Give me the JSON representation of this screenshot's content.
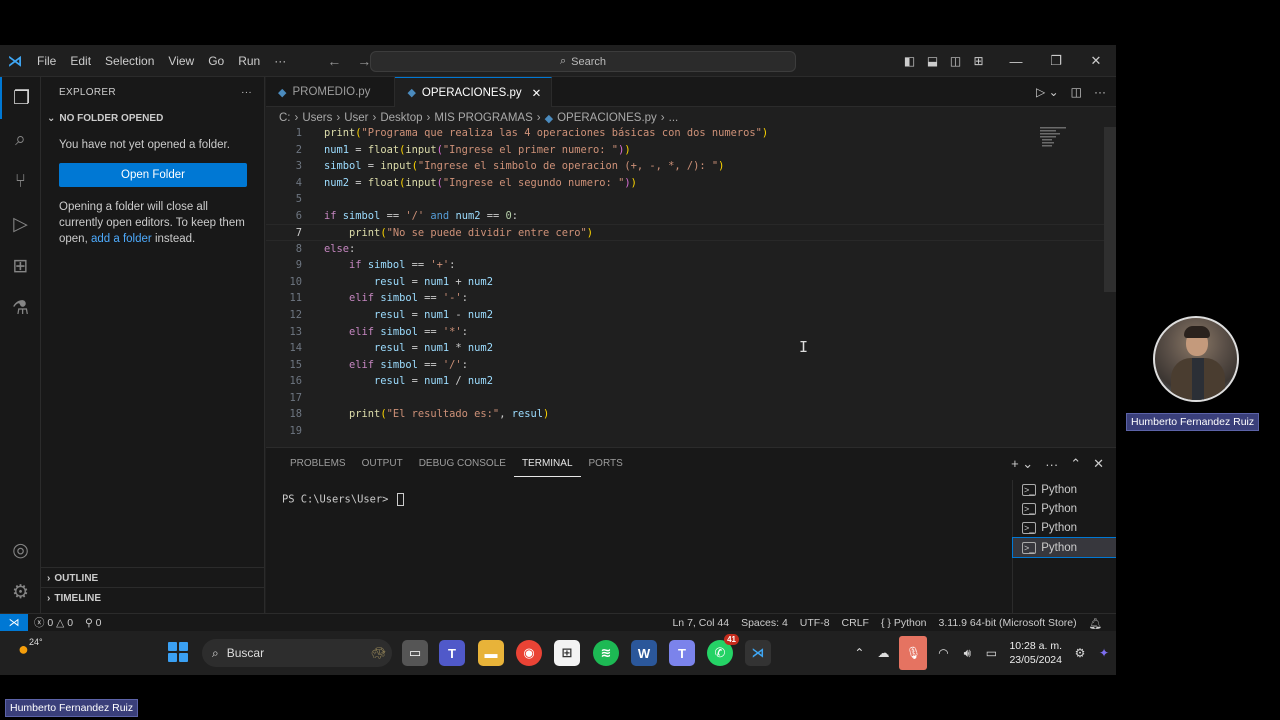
{
  "menu": [
    "File",
    "Edit",
    "Selection",
    "View",
    "Go",
    "Run",
    "···"
  ],
  "search": {
    "label": "Search"
  },
  "explorer": {
    "title": "EXPLORER",
    "section": "NO FOLDER OPENED",
    "message": "You have not yet opened a folder.",
    "open_folder": "Open Folder",
    "info_pre": "Opening a folder will close all currently open editors. To keep them open,",
    "info_link": "add a folder",
    "info_post": "instead.",
    "outline": "OUTLINE",
    "timeline": "TIMELINE"
  },
  "tabs": [
    {
      "label": "PROMEDIO.py"
    },
    {
      "label": "OPERACIONES.py"
    }
  ],
  "breadcrumb": [
    "C:",
    "Users",
    "User",
    "Desktop",
    "MIS PROGRAMAS",
    "OPERACIONES.py",
    "..."
  ],
  "code_lines": [
    {
      "n": "1",
      "text": "print(\"Programa que realiza las 4 operaciones básicas con dos numeros\")"
    },
    {
      "n": "2",
      "text": "num1 = float(input(\"Ingrese el primer numero: \"))"
    },
    {
      "n": "3",
      "text": "simbol = input(\"Ingrese el simbolo de operacion (+, -, *, /): \")"
    },
    {
      "n": "4",
      "text": "num2 = float(input(\"Ingrese el segundo numero: \"))"
    },
    {
      "n": "5",
      "text": ""
    },
    {
      "n": "6",
      "text": "if simbol == '/' and num2 == 0:"
    },
    {
      "n": "7",
      "text": "    print(\"No se puede dividir entre cero\")"
    },
    {
      "n": "8",
      "text": "else:"
    },
    {
      "n": "9",
      "text": "    if simbol == '+':"
    },
    {
      "n": "10",
      "text": "        resul = num1 + num2"
    },
    {
      "n": "11",
      "text": "    elif simbol == '-':"
    },
    {
      "n": "12",
      "text": "        resul = num1 - num2"
    },
    {
      "n": "13",
      "text": "    elif simbol == '*':"
    },
    {
      "n": "14",
      "text": "        resul = num1 * num2"
    },
    {
      "n": "15",
      "text": "    elif simbol == '/':"
    },
    {
      "n": "16",
      "text": "        resul = num1 / num2"
    },
    {
      "n": "17",
      "text": ""
    },
    {
      "n": "18",
      "text": "    print(\"El resultado es:\", resul)"
    },
    {
      "n": "19",
      "text": ""
    }
  ],
  "current_line": "7",
  "panel": {
    "tabs": [
      "PROBLEMS",
      "OUTPUT",
      "DEBUG CONSOLE",
      "TERMINAL",
      "PORTS"
    ],
    "active_tab": "TERMINAL",
    "prompt": "PS C:\\Users\\User> ",
    "terminals": [
      "Python",
      "Python",
      "Python",
      "Python"
    ]
  },
  "status": {
    "errors": "0",
    "warnings": "0",
    "ports": "0",
    "position": "Ln 7, Col 44",
    "spaces": "Spaces: 4",
    "encoding": "UTF-8",
    "eol": "CRLF",
    "language": "Python",
    "interpreter": "3.11.9 64-bit (Microsoft Store)"
  },
  "taskbar": {
    "temperature": "24°",
    "search_label": "Buscar",
    "whatsapp_badge": "41",
    "time": "10:28 a. m.",
    "date": "23/05/2024"
  },
  "presenter": {
    "name_right": "Humberto Fernandez Ruiz",
    "name_bottom": "Humberto Fernandez Ruiz"
  },
  "colors": {
    "accent": "#0078d4",
    "editor_bg": "#1f1f1f",
    "sidebar_bg": "#181818"
  }
}
